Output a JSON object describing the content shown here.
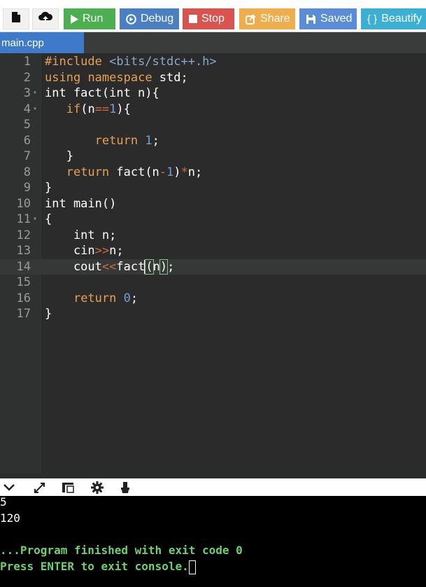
{
  "toolbar": {
    "new_file_icon": "file-icon",
    "upload_icon": "cloud-upload-icon",
    "buttons": [
      {
        "label": "Run",
        "icon": "play-icon",
        "color": "#4caf50"
      },
      {
        "label": "Debug",
        "icon": "debug-icon",
        "color": "#4a7fc1"
      },
      {
        "label": "Stop",
        "icon": "stop-icon",
        "color": "#d9534f"
      },
      {
        "label": "Share",
        "icon": "share-icon",
        "color": "#f0ad4e"
      },
      {
        "label": "Saved",
        "icon": "save-icon",
        "color": "#5b8dd6"
      },
      {
        "label": "Beautify",
        "icon": "braces-icon",
        "glyph": "{ }",
        "color": "#3cb0d4"
      }
    ]
  },
  "tabs": [
    {
      "label": "main.cpp",
      "active": true
    }
  ],
  "editor": {
    "active_line": 14,
    "lines": [
      {
        "n": "1",
        "text": "#include <bits/stdc++.h>"
      },
      {
        "n": "2",
        "text": "using namespace std;"
      },
      {
        "n": "3",
        "text": "int fact(int n){",
        "fold": true
      },
      {
        "n": "4",
        "text": "   if(n==1){",
        "fold": true
      },
      {
        "n": "5",
        "text": ""
      },
      {
        "n": "6",
        "text": "       return 1;"
      },
      {
        "n": "7",
        "text": "   }"
      },
      {
        "n": "8",
        "text": "   return fact(n-1)*n;"
      },
      {
        "n": "9",
        "text": "}"
      },
      {
        "n": "10",
        "text": "int main()"
      },
      {
        "n": "11",
        "text": "{",
        "fold": true
      },
      {
        "n": "12",
        "text": "    int n;"
      },
      {
        "n": "13",
        "text": "    cin>>n;"
      },
      {
        "n": "14",
        "text": "    cout<<fact(n);"
      },
      {
        "n": "15",
        "text": ""
      },
      {
        "n": "16",
        "text": "    return 0;"
      },
      {
        "n": "17",
        "text": "}"
      }
    ]
  },
  "console_toolbar": {
    "icons": [
      "chevron-down-icon",
      "expand-icon",
      "layout-icon",
      "gear-icon",
      "clear-console-icon"
    ]
  },
  "console": {
    "lines": [
      {
        "text": "5",
        "style": "plain"
      },
      {
        "text": "120",
        "style": "plain"
      },
      {
        "text": "",
        "style": "plain"
      },
      {
        "text": "...Program finished with exit code 0",
        "style": "green"
      },
      {
        "text": "Press ENTER to exit console.",
        "style": "green"
      }
    ]
  }
}
